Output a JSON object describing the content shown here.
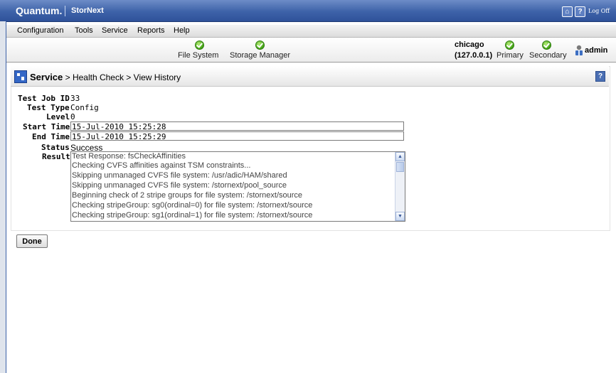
{
  "header": {
    "logo": "Quantum.",
    "product": "StorNext",
    "logoff_label": "Log Off"
  },
  "menu": [
    "Configuration",
    "Tools",
    "Service",
    "Reports",
    "Help"
  ],
  "status": {
    "file_system": "File System",
    "storage_manager": "Storage Manager",
    "host_name": "chicago",
    "host_ip": "(127.0.0.1)",
    "primary": "Primary",
    "secondary": "Secondary",
    "user": "admin"
  },
  "breadcrumb": {
    "section": "Service",
    "trail": " > Health Check > View History"
  },
  "details": {
    "test_job_id_label": "Test Job ID",
    "test_job_id": "33",
    "test_type_label": "Test Type",
    "test_type": "Config",
    "level_label": "Level",
    "level": "0",
    "start_time_label": "Start Time",
    "start_time": "15-Jul-2010 15:25:28",
    "end_time_label": "End Time",
    "end_time": "15-Jul-2010 15:25:29",
    "status_label": "Status",
    "status": "Success",
    "result_label": "Result",
    "result_lines": [
      "Test Response: fsCheckAffinities",
      "Checking CVFS affinities against TSM constraints...",
      "Skipping unmanaged CVFS file system: /usr/adic/HAM/shared",
      "Skipping unmanaged CVFS file system: /stornext/pool_source",
      "Beginning check of 2 stripe groups for file system: /stornext/source",
      "Checking stripeGroup: sg0(ordinal=0) for file system: /stornext/source",
      "Checking stripeGroup: sg1(ordinal=1) for file system: /stornext/source"
    ]
  },
  "actions": {
    "done": "Done"
  }
}
